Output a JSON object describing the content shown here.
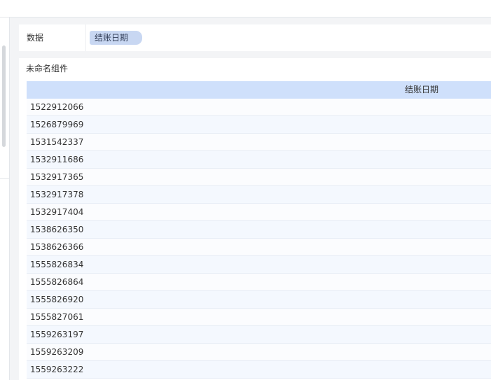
{
  "data_bar": {
    "label": "数据",
    "chip": "结账日期"
  },
  "widget": {
    "title": "未命名组件",
    "table": {
      "columns": [
        "",
        "结账日期"
      ],
      "rows": [
        "1522912066",
        "1526879969",
        "1531542337",
        "1532911686",
        "1532917365",
        "1532917378",
        "1532917404",
        "1538626350",
        "1538626366",
        "1555826834",
        "1555826864",
        "1555826920",
        "1555827061",
        "1559263197",
        "1559263209",
        "1559263222"
      ]
    }
  },
  "colors": {
    "header_bg": "#cfe0fb",
    "chip_bg": "#c8d7f2",
    "row_odd": "#f4f8fe",
    "row_even": "#fbfcfe"
  }
}
